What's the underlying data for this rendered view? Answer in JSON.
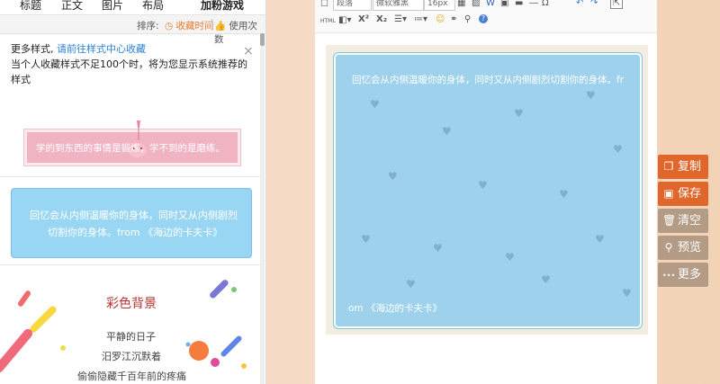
{
  "nav": {
    "tabs": [
      "标题",
      "正文",
      "图片",
      "布局",
      "加粉游戏"
    ]
  },
  "sort": {
    "label": "排序:",
    "active": "收藏时间",
    "separator": "|",
    "count": "使用次数"
  },
  "notice": {
    "line1_prefix": "更多样式,",
    "line1_link": "请前往样式中心收藏",
    "line2": "当个人收藏样式不足100个时，将为您显示系统推荐的样式",
    "close": "×"
  },
  "card_pink": {
    "text": "学的到东西的事情是锻炼，学不到的是磨练。"
  },
  "card_blue": {
    "line1": "回忆会从内侧温暖你的身体，同时又从内侧剧烈",
    "line2": "切割你的身体。from 《海边的卡夫卡》"
  },
  "card_color": {
    "title": "彩色背景",
    "p1": "平静的日子",
    "p2": "汨罗江沉默着",
    "p3": "偷偷隐藏千百年前的疼痛"
  },
  "editor": {
    "para_select": "段落",
    "font_select": "微软雅黑",
    "size_select": "16px",
    "line1": "回忆会从内侧温暖你的身体，同时又从内侧剧烈切割你的身体。fr",
    "line2": "om 《海边的卡夫卡》"
  },
  "actions": [
    {
      "label": "复制",
      "icon": "copy-icon",
      "glyph": "❐",
      "color": "#e1662b"
    },
    {
      "label": "保存",
      "icon": "save-icon",
      "glyph": "▣",
      "color": "#e1662b"
    },
    {
      "label": "清空",
      "icon": "trash-icon",
      "glyph": "🗑",
      "color": "#b39b86"
    },
    {
      "label": "预览",
      "icon": "search-icon",
      "glyph": "⚲",
      "color": "#b39b86"
    },
    {
      "label": "更多",
      "icon": "more-icon",
      "glyph": "•••",
      "color": "#b39b86"
    }
  ]
}
